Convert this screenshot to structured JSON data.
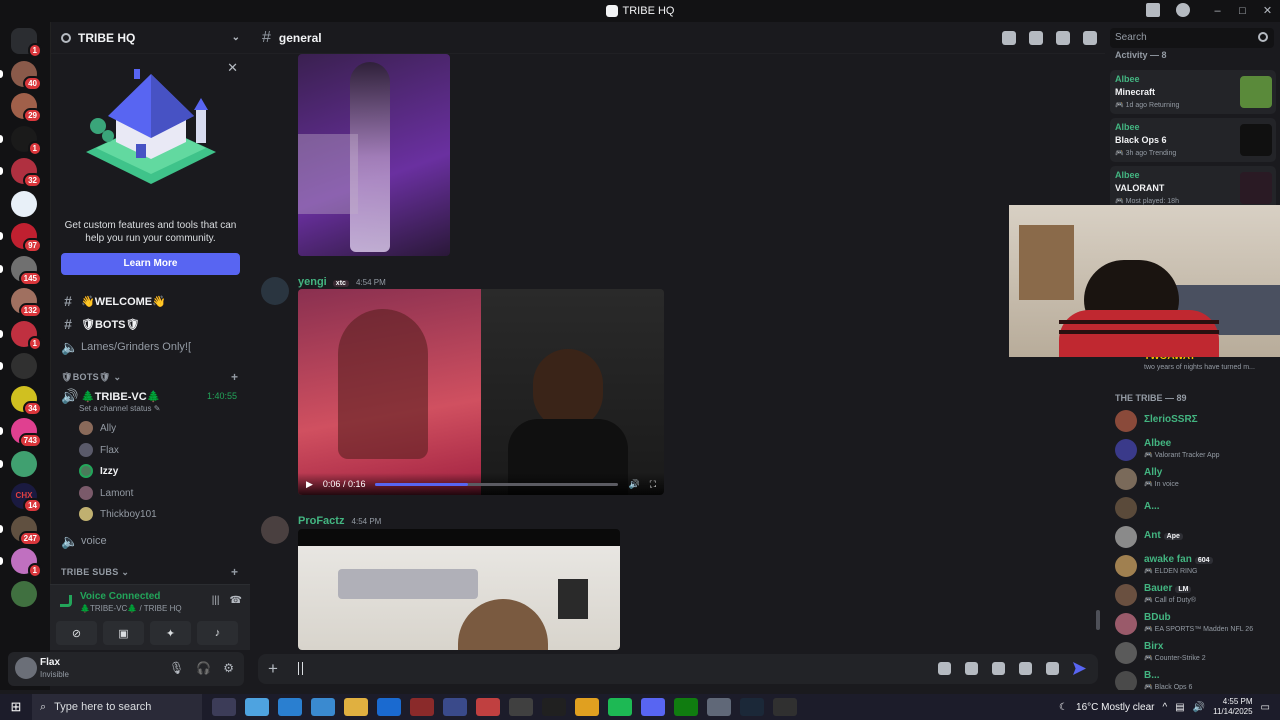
{
  "window": {
    "title": "TRIBE HQ",
    "controls": [
      "–",
      "□",
      "✕"
    ]
  },
  "rail": {
    "servers": [
      {
        "color": "#2b2d31",
        "badge": "1",
        "icon": "discord-home-icon"
      },
      {
        "color": "#8a5a4a",
        "badge": "40"
      },
      {
        "color": "#a0604a",
        "badge": "29"
      },
      {
        "color": "#1a1a1a",
        "badge": "1",
        "fg": "#53fc18"
      },
      {
        "color": "#b03040",
        "badge": "32"
      },
      {
        "color": "#e8f0f8",
        "badge": ""
      },
      {
        "color": "#c02030",
        "badge": "97"
      },
      {
        "color": "#707070",
        "badge": "145"
      },
      {
        "color": "#a07060",
        "badge": "132"
      },
      {
        "color": "#c03040",
        "badge": "1"
      },
      {
        "color": "#303030",
        "badge": ""
      },
      {
        "color": "#d0c020",
        "badge": "34"
      },
      {
        "color": "#e04090",
        "badge": "743"
      },
      {
        "color": "#40a070",
        "badge": ""
      },
      {
        "color": "#1a1a40",
        "badge": "14",
        "label": "CHX"
      },
      {
        "color": "#605040",
        "badge": "247"
      },
      {
        "color": "#c070c0",
        "badge": "1"
      },
      {
        "color": "#407040",
        "badge": ""
      }
    ]
  },
  "sidebar": {
    "guild_name": "TRIBE HQ",
    "promo_text": "Get custom features and tools that can help you run your community.",
    "learn_more": "Learn More",
    "channels": [
      {
        "name": "👋WELCOME👋",
        "kind": "text",
        "bold": true
      },
      {
        "name": "🛡BOTS🛡",
        "kind": "text",
        "bold": true
      },
      {
        "name": "Lames/Grinders Only![",
        "kind": "voice",
        "bold": false
      }
    ],
    "category_bots": "🛡BOTS🛡",
    "voice_channel": {
      "name": "🌲TRIBE-VC🌲",
      "timer": "1:40:55",
      "status_hint": "Set a channel status"
    },
    "voice_users": [
      "Ally",
      "Flax",
      "Izzy",
      "Lamont",
      "Thickboy101"
    ],
    "voice_extra": "voice",
    "category_subs": "TRIBE SUBS"
  },
  "voice_panel": {
    "status": "Voice Connected",
    "location": "🌲TRIBE-VC🌲 / TRIBE HQ"
  },
  "user_panel": {
    "name": "Flax",
    "status": "Invisible"
  },
  "chat": {
    "channel": "general",
    "messages": [
      {
        "author": "yengi",
        "tag": "xtc",
        "time": "4:54 PM",
        "video_time": "0:06 / 0:16",
        "progress": 0.38
      },
      {
        "author": "ProFactz",
        "time": "4:54 PM"
      }
    ]
  },
  "search": {
    "placeholder": "Search"
  },
  "members": {
    "activity_label": "Activity — 8",
    "activities": [
      {
        "name": "Albee",
        "game": "Minecraft",
        "detail": "1d ago  Returning",
        "color": "#5a8a3a"
      },
      {
        "name": "Albee",
        "game": "Black Ops 6",
        "detail": "3h ago  Trending",
        "color": "#101010"
      },
      {
        "name": "Albee",
        "game": "VALORANT",
        "detail": "Most played: 18h",
        "color": "#2a1a24"
      }
    ],
    "twoaway": {
      "name": "TWOAWAY",
      "status": "two years of nights have turned m..."
    },
    "tribe_label": "THE TRIBE — 89",
    "list": [
      {
        "name": "ΣlerioSSRΣ",
        "status": "",
        "color": "#8a4a3a"
      },
      {
        "name": "Albee",
        "status": "Valorant Tracker App",
        "color": "#3a3a8a"
      },
      {
        "name": "Ally",
        "status": "In voice",
        "color": "#7a6a5a"
      },
      {
        "name": "A...",
        "status": "",
        "color": "#5a4a3a"
      },
      {
        "name": "Ant",
        "tag": "Ape",
        "status": "",
        "color": "#8a8a8a"
      },
      {
        "name": "awake fan",
        "tag": "604",
        "status": "ELDEN RING",
        "color": "#a08050"
      },
      {
        "name": "Bauer",
        "tag": "LM",
        "status": "Call of Duty®",
        "color": "#6a5040"
      },
      {
        "name": "BDub",
        "status": "EA SPORTS™ Madden NFL 26",
        "color": "#9a5a6a"
      },
      {
        "name": "Birx",
        "status": "Counter-Strike 2",
        "color": "#5a5a5a"
      },
      {
        "name": "B...",
        "status": "Black Ops 6",
        "color": "#4a4a4a"
      }
    ]
  },
  "taskbar": {
    "search": "Type here to search",
    "weather": "16°C  Mostly clear",
    "time": "4:55 PM",
    "date": "11/14/2025"
  }
}
